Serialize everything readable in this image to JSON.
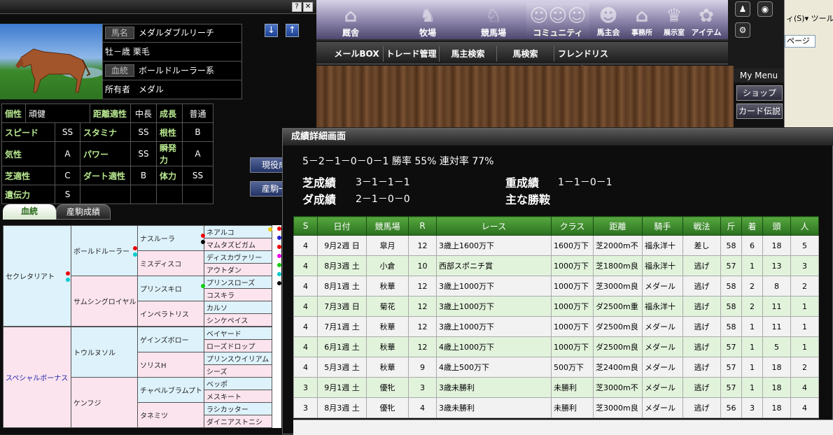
{
  "horse": {
    "name_label": "馬名",
    "name": "メダルダブルリーチ",
    "sex_age": "牡－歳 栗毛",
    "line_label": "血統",
    "line": "ボールドルーラー系",
    "owner_label": "所有者",
    "owner": "メダル"
  },
  "stats": {
    "rows": [
      [
        {
          "l": "個性",
          "v": "頑健"
        },
        {
          "l": "距離適性",
          "v": "中長"
        },
        {
          "l": "成長",
          "v": "普通"
        }
      ],
      [
        {
          "l": "スピード",
          "v": "SS"
        },
        {
          "l": "スタミナ",
          "v": "SS"
        },
        {
          "l": "根性",
          "v": "B"
        }
      ],
      [
        {
          "l": "気性",
          "v": "A"
        },
        {
          "l": "パワー",
          "v": "SS"
        },
        {
          "l": "瞬発力",
          "v": "A"
        }
      ],
      [
        {
          "l": "芝適性",
          "v": "C"
        },
        {
          "l": "ダート適性",
          "v": "B"
        },
        {
          "l": "体力",
          "v": "SS"
        }
      ],
      [
        {
          "l": "遺伝力",
          "v": "S"
        }
      ]
    ]
  },
  "side_buttons": [
    "現役成",
    "産駒一"
  ],
  "tabs": [
    "血統",
    "産駒成績"
  ],
  "pedigree": {
    "g1": [
      "セクレタリアト",
      "スペシャルボーナス"
    ],
    "g2": [
      "ボールドルーラー",
      "サムシングロイヤル",
      "トウルヌソル",
      "ケンフジ"
    ],
    "g3": [
      "ナスルーラ",
      "ミスディスコ",
      "プリンスキロ",
      "インペラトリス",
      "ゲインズボロー",
      "ソリスH",
      "チャペルブラムプト",
      "タネミツ"
    ],
    "g4": [
      "ネアルコ",
      "マムタズビガム",
      "ディスカヴァリー",
      "アウトダン",
      "プリンスローズ",
      "コスキラ",
      "カルソ",
      "シンケペイス",
      "ベイヤード",
      "ローズドロップ",
      "プリンスウイリアム",
      "シーズ",
      "ベッポ",
      "メスキート",
      "ラシカッター",
      "ダイニアストニシ"
    ]
  },
  "nav": {
    "items": [
      "厩舎",
      "牧場",
      "競馬場",
      "コミュニティ",
      "馬主会",
      "事務所",
      "展示室",
      "アイテム"
    ],
    "sub": [
      "メールBOX",
      "トレード管理",
      "馬主検索",
      "馬検索",
      "フレンドリスト"
    ]
  },
  "mymenu": {
    "title": "My Menu",
    "items": [
      "ショップ",
      "カード伝説"
    ]
  },
  "browser": {
    "menu": "ィ(S)▾ ツール",
    "field": "ページ"
  },
  "modal": {
    "title": "成績詳細画面",
    "summary": "5－2－1－0－0－1  勝率 55%  連対率 77%",
    "turf_label": "芝成績",
    "turf": "3－1－1－1",
    "dirt_label": "ダ成績",
    "dirt": "2－1－0－0",
    "heavy_label": "重成績",
    "heavy": "1－1－0－1",
    "main_label": "主な勝鞍",
    "headers": [
      "S",
      "日付",
      "競馬場",
      "R",
      "レース",
      "クラス",
      "距離",
      "騎手",
      "戦法",
      "斤",
      "着",
      "頭",
      "人"
    ],
    "rows": [
      [
        "4",
        "9月2週 日",
        "皐月",
        "12",
        "3歳上1600万下",
        "1600万下",
        "芝2000m不",
        "福永洋十",
        "差し",
        "58",
        "6",
        "18",
        "5"
      ],
      [
        "4",
        "8月3週 土",
        "小倉",
        "10",
        "西部スポニチ賞",
        "1000万下",
        "芝1800m良",
        "福永洋十",
        "逃げ",
        "57",
        "1",
        "13",
        "3"
      ],
      [
        "4",
        "8月1週 土",
        "秋華",
        "12",
        "3歳上1000万下",
        "1000万下",
        "芝3000m良",
        "メダール",
        "逃げ",
        "58",
        "2",
        "8",
        "2"
      ],
      [
        "4",
        "7月3週 日",
        "菊花",
        "12",
        "3歳上1000万下",
        "1000万下",
        "ダ2500m重",
        "福永洋十",
        "逃げ",
        "58",
        "2",
        "11",
        "1"
      ],
      [
        "4",
        "7月1週 土",
        "秋華",
        "12",
        "3歳上1000万下",
        "1000万下",
        "ダ2500m良",
        "メダール",
        "逃げ",
        "58",
        "1",
        "11",
        "1"
      ],
      [
        "4",
        "6月1週 土",
        "秋華",
        "12",
        "4歳上1000万下",
        "1000万下",
        "ダ2500m良",
        "メダール",
        "逃げ",
        "57",
        "1",
        "5",
        "1"
      ],
      [
        "4",
        "5月3週 土",
        "秋華",
        "9",
        "4歳上500万下",
        "500万下",
        "芝2400m良",
        "メダール",
        "逃げ",
        "57",
        "1",
        "18",
        "2"
      ],
      [
        "3",
        "9月1週 土",
        "優牝",
        "3",
        "3歳未勝利",
        "未勝利",
        "芝3000m不",
        "メダール",
        "逃げ",
        "57",
        "1",
        "18",
        "4"
      ],
      [
        "3",
        "8月3週 土",
        "優牝",
        "4",
        "3歳未勝利",
        "未勝利",
        "芝3000m良",
        "メダール",
        "逃げ",
        "56",
        "3",
        "18",
        "4"
      ]
    ]
  }
}
